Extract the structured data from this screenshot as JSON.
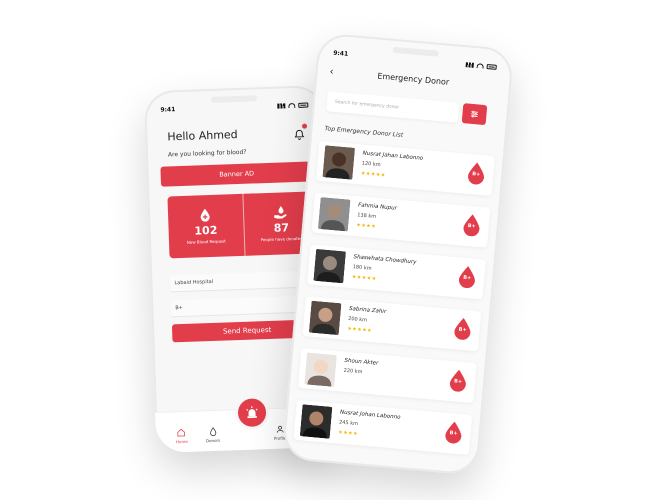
{
  "left_phone": {
    "time": "9:41",
    "greeting": "Hello Ahmed",
    "question": "Are you looking for blood?",
    "banner": "Banner AD",
    "stats": [
      {
        "value": "102",
        "label": "New Blood Request"
      },
      {
        "value": "87",
        "label": "People have donated"
      }
    ],
    "hospital_field": "Labaid Hospital",
    "blood_group_field": "B+",
    "send_button": "Send Request",
    "tabs": {
      "home": "Home",
      "donors": "Donors",
      "profile": "Profile"
    }
  },
  "right_phone": {
    "time": "9:41",
    "title": "Emergency Donor",
    "search_placeholder": "Search for emergency donor",
    "list_title": "Top Emergency Donor List",
    "donors": [
      {
        "name": "Nusrat Jahan Labonno",
        "distance": "120 km",
        "stars": "★★★★★",
        "blood": "B+"
      },
      {
        "name": "Fahmia Nupur",
        "distance": "138 km",
        "stars": "★★★★",
        "blood": "B+"
      },
      {
        "name": "Shaswhata Chowdhury",
        "distance": "180 km",
        "stars": "★★★★★",
        "blood": "B+"
      },
      {
        "name": "Sabrina Zahir",
        "distance": "200 km",
        "stars": "★★★★★",
        "blood": "B+"
      },
      {
        "name": "Shoun Akter",
        "distance": "220 km",
        "stars": "",
        "blood": "B+"
      },
      {
        "name": "Nusrat Johan Labonno",
        "distance": "245 km",
        "stars": "★★★★",
        "blood": "B+"
      }
    ]
  },
  "colors": {
    "accent": "#e23d4b",
    "star": "#f2b705"
  },
  "icons": [
    "bell-icon",
    "blood-drop-plus-icon",
    "hand-drop-icon",
    "home-icon",
    "drop-icon",
    "siren-icon",
    "user-icon",
    "back-arrow-icon",
    "filter-icon"
  ]
}
